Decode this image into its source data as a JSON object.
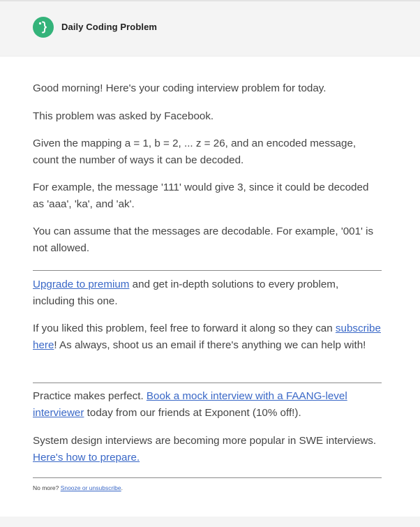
{
  "header": {
    "brand": "Daily Coding Problem",
    "logo_icon": "brace-logo-icon",
    "accent": "#34b37a"
  },
  "body": {
    "greeting": "Good morning! Here's your coding interview problem for today.",
    "asked_by": "This problem was asked by Facebook.",
    "problem": "Given the mapping a = 1, b = 2, ... z = 26, and an encoded message, count the number of ways it can be decoded.",
    "example": "For example, the message '111' would give 3, since it could be decoded as 'aaa', 'ka', and 'ak'.",
    "assumption": "You can assume that the messages are decodable. For example, '001' is not allowed."
  },
  "premium": {
    "link": "Upgrade to premium",
    "text": " and get in-depth solutions to every problem, including this one."
  },
  "forward": {
    "pre": "If you liked this problem, feel free to forward it along so they can ",
    "link": "subscribe here",
    "post": "! As always, shoot us an email if there's anything we can help with!"
  },
  "practice": {
    "pre": "Practice makes perfect. ",
    "link": "Book a mock interview with a FAANG-level interviewer",
    "post": " today from our friends at Exponent (10% off!)."
  },
  "system": {
    "pre": "System design interviews are becoming more popular in SWE interviews. ",
    "link": "Here's how to prepare."
  },
  "footer": {
    "pre": "No more? ",
    "link": "Snooze or unsubscribe",
    "post": "."
  },
  "colors": {
    "link": "#3a68c7",
    "text": "#454545"
  }
}
